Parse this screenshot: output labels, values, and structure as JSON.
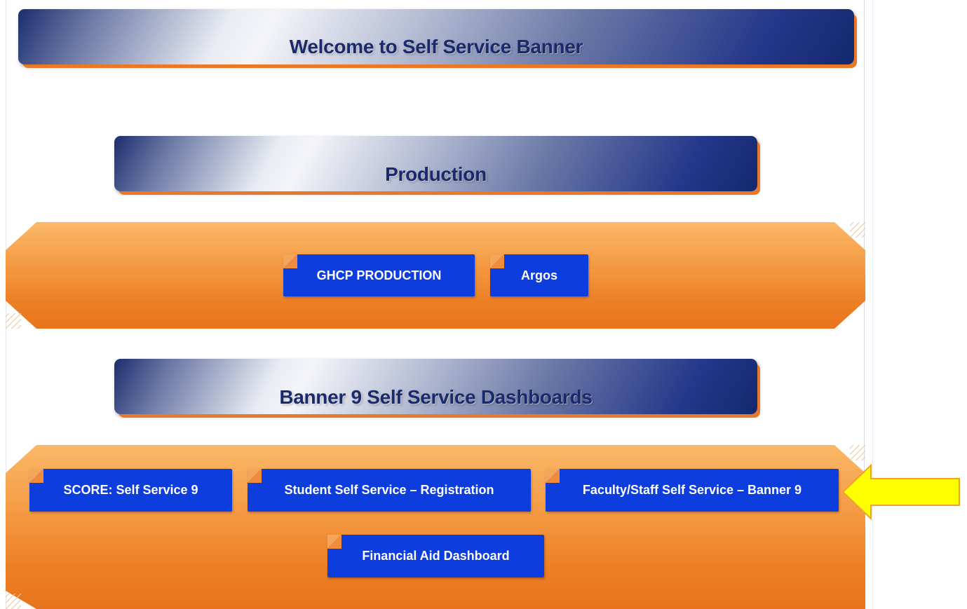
{
  "header": {
    "welcome_title": "Welcome to Self Service Banner"
  },
  "production": {
    "title": "Production",
    "links": [
      {
        "label": "GHCP PRODUCTION"
      },
      {
        "label": "Argos"
      }
    ]
  },
  "dashboards": {
    "title": "Banner 9 Self Service Dashboards",
    "links": [
      {
        "label": "SCORE: Self Service 9"
      },
      {
        "label": "Student Self Service – Registration"
      },
      {
        "label": "Faculty/Staff Self Service – Banner 9"
      },
      {
        "label": "Financial Aid Dashboard"
      }
    ]
  },
  "annotation": {
    "arrow_icon": "yellow-arrow-left-icon",
    "arrow_color": "#ffff00",
    "arrow_outline": "#f0a030"
  },
  "colors": {
    "banner_text": "#1a2a6c",
    "button_blue": "#0d3ddc",
    "panel_orange": "#f49b44"
  }
}
